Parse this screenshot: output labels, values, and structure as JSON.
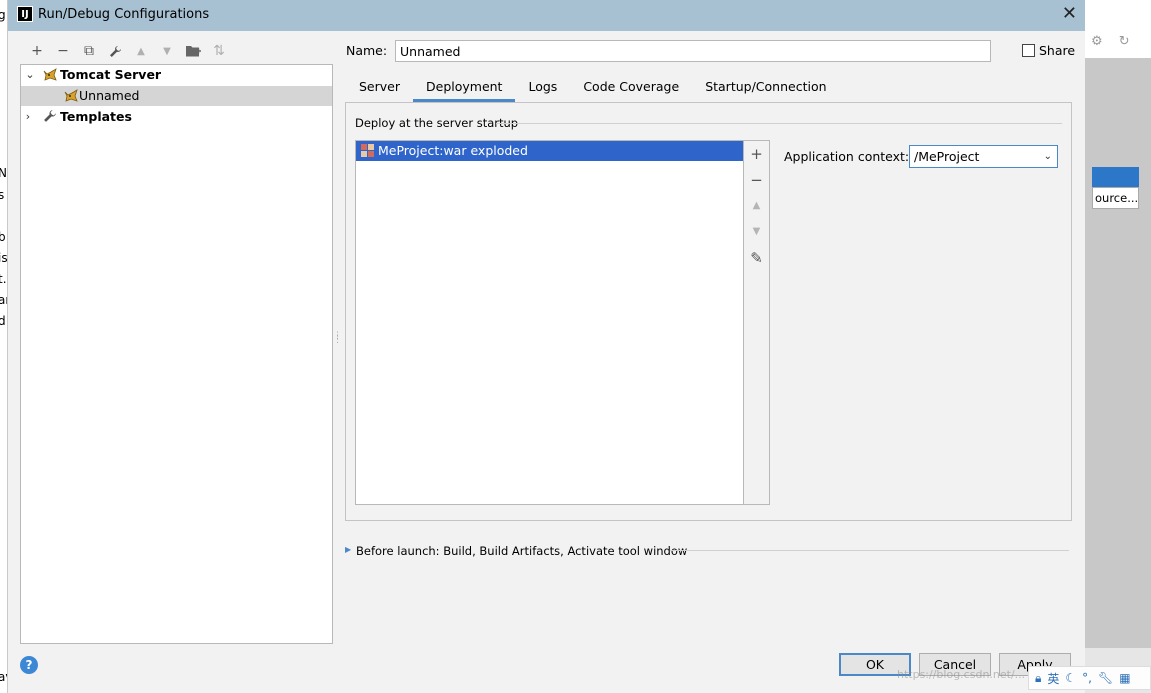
{
  "window": {
    "title": "Run/Debug Configurations",
    "app_icon_text": "IJ"
  },
  "background_left_fragments": [
    "g",
    "N",
    "s",
    "b",
    "is",
    "t.",
    "ar",
    "d",
    "av"
  ],
  "background_right": {
    "button_text": "ource..."
  },
  "left_toolbar": {
    "items": [
      {
        "icon": "plus-icon",
        "glyph": "+"
      },
      {
        "icon": "minus-icon",
        "glyph": "−"
      },
      {
        "icon": "copy-icon",
        "glyph": "⧉"
      },
      {
        "icon": "wrench-icon",
        "glyph": "🔧"
      },
      {
        "icon": "arrow-up-icon",
        "glyph": "▲"
      },
      {
        "icon": "arrow-down-icon",
        "glyph": "▼"
      },
      {
        "icon": "folder-icon",
        "glyph": "▆"
      },
      {
        "icon": "sort-icon",
        "glyph": "⇅"
      }
    ]
  },
  "tree": {
    "items": [
      {
        "label": "Tomcat Server",
        "icon": "tomcat-icon",
        "expanded": true
      },
      {
        "label": "Unnamed",
        "icon": "tomcat-icon",
        "selected": true
      },
      {
        "label": "Templates",
        "icon": "wrench-icon",
        "expanded": false
      }
    ]
  },
  "name_field": {
    "label": "Name:",
    "value": "Unnamed"
  },
  "share": {
    "label": "Share",
    "checked": false
  },
  "tabs": [
    {
      "label": "Server"
    },
    {
      "label": "Deployment",
      "active": true
    },
    {
      "label": "Logs"
    },
    {
      "label": "Code Coverage"
    },
    {
      "label": "Startup/Connection"
    }
  ],
  "deployment": {
    "section_label": "Deploy at the server startup",
    "artifacts": [
      {
        "label": "MeProject:war exploded",
        "selected": true
      }
    ],
    "side_buttons": [
      {
        "icon": "plus-icon",
        "glyph": "+"
      },
      {
        "icon": "minus-icon",
        "glyph": "−"
      },
      {
        "icon": "arrow-up-icon",
        "glyph": "▲"
      },
      {
        "icon": "arrow-down-icon",
        "glyph": "▼"
      },
      {
        "icon": "pencil-icon",
        "glyph": "✎"
      }
    ],
    "context_label": "Application context:",
    "context_value": "/MeProject"
  },
  "before_launch": {
    "text": "Before launch: Build, Build Artifacts, Activate tool window"
  },
  "buttons": {
    "help": "?",
    "ok": "OK",
    "cancel": "Cancel",
    "apply": "Apply"
  },
  "watermark": "https://blog.csdn.net/...",
  "tray": {
    "ime": "英"
  },
  "colors": {
    "titlebar": "#a7c1d3",
    "selection": "#2f65ca",
    "tab_underline": "#4a88c7",
    "dialog_bg": "#f2f2f2"
  }
}
